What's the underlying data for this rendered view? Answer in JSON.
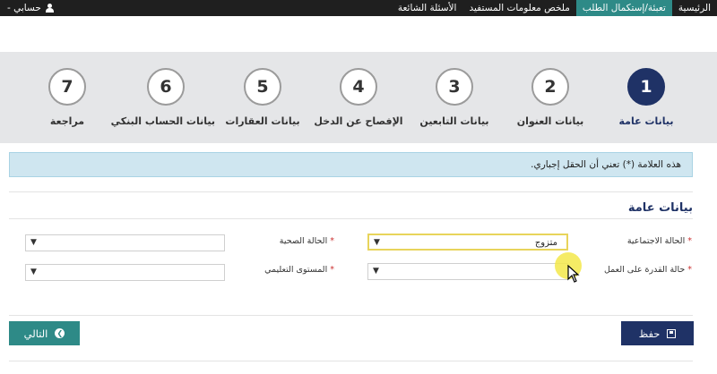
{
  "nav": {
    "items": [
      "الرئيسية",
      "تعبئة/إستكمال الطلب",
      "ملخص معلومات المستفيد",
      "الأسئلة الشائعة"
    ],
    "active_index": 1,
    "account_label": "حسابي -"
  },
  "steps": [
    {
      "number": "1",
      "label": "بيانات عامة",
      "active": true
    },
    {
      "number": "2",
      "label": "بيانات العنوان",
      "active": false
    },
    {
      "number": "3",
      "label": "بيانات التابعين",
      "active": false
    },
    {
      "number": "4",
      "label": "الإفصاح عن الدخل",
      "active": false
    },
    {
      "number": "5",
      "label": "بيانات العقارات",
      "active": false
    },
    {
      "number": "6",
      "label": "بيانات الحساب البنكي",
      "active": false
    },
    {
      "number": "7",
      "label": "مراجعة",
      "active": false
    }
  ],
  "info_message": "هذه العلامة (*) تعني أن الحقل إجباري.",
  "section_title": "بيانات عامة",
  "fields": {
    "social_status": {
      "label": "الحالة الاجتماعية",
      "value": "متزوج"
    },
    "health_status": {
      "label": "الحالة الصحية",
      "value": ""
    },
    "work_ability": {
      "label": "حالة القدرة على العمل",
      "value": ""
    },
    "education_level": {
      "label": "المستوى التعليمي",
      "value": ""
    }
  },
  "required_mark": "*",
  "dropdown_arrow": "▼",
  "buttons": {
    "save": "حفظ",
    "next": "التالي"
  },
  "colors": {
    "primary": "#1f3266",
    "teal": "#2e8a87",
    "info_bg": "#cfe6f0",
    "topbar": "#1f1f1f"
  }
}
